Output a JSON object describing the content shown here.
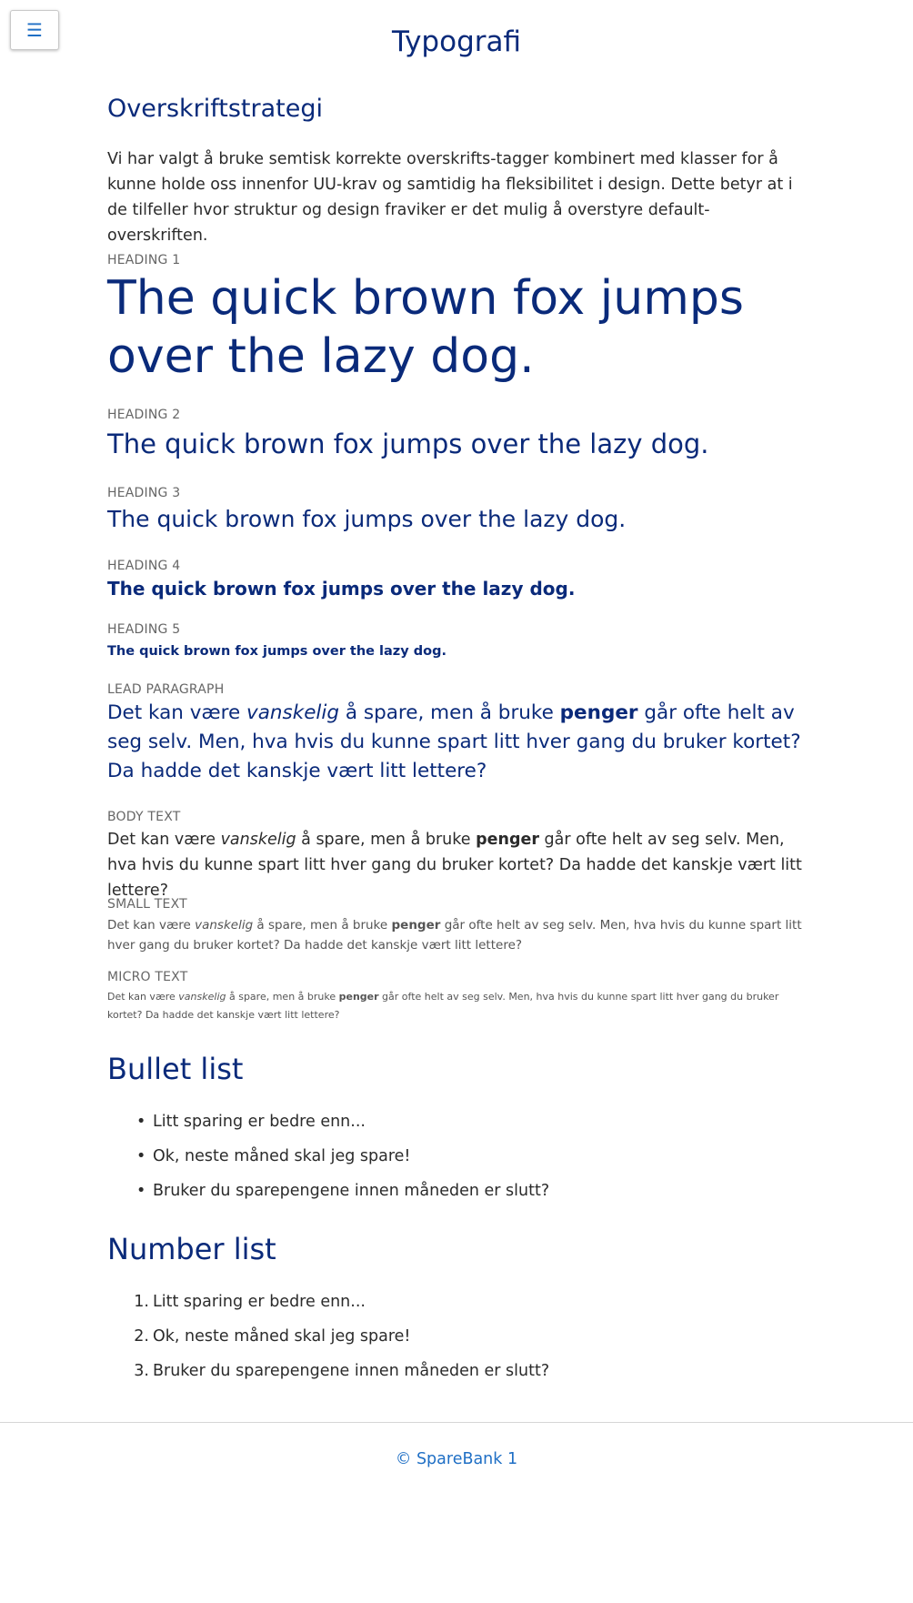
{
  "menu": {
    "icon": "hamburger-menu-icon",
    "glyph": "☰"
  },
  "page_title": "Typografi",
  "strategy": {
    "title": "Overskriftstrategi",
    "text": "Vi har valgt å bruke semtisk korrekte overskrifts-tagger kombinert med klasser for å kunne holde oss innenfor UU-krav og samtidig ha fleksibilitet i design. Dette betyr at i de tilfeller hvor struktur og design fraviker er det mulig å overstyre default-overskriften."
  },
  "headings": [
    {
      "label": "HEADING 1",
      "text": "The quick brown fox jumps over the lazy dog."
    },
    {
      "label": "HEADING 2",
      "text": "The quick brown fox jumps over the lazy dog."
    },
    {
      "label": "HEADING 3",
      "text": "The quick brown fox jumps over the lazy dog."
    },
    {
      "label": "HEADING 4",
      "text": "The quick brown fox jumps over the lazy dog."
    },
    {
      "label": "HEADING 5",
      "text": "The quick brown fox jumps over the lazy dog."
    }
  ],
  "sample": {
    "part1": "Det kan være ",
    "italic": "vanskelig",
    "part2": " å spare, men å bruke ",
    "bold": "penger",
    "part3": " går ofte helt av seg selv. Men, hva hvis du kunne spart litt hver gang du bruker kortet? Da hadde det kanskje vært litt lettere?"
  },
  "text_styles": {
    "lead_label": "LEAD PARAGRAPH",
    "body_label": "BODY TEXT",
    "small_label": "SMALL TEXT",
    "micro_label": "MICRO TEXT"
  },
  "bullet_list": {
    "title": "Bullet list",
    "marker": "•",
    "items": [
      "Litt sparing er bedre enn...",
      "Ok, neste måned skal jeg spare!",
      "Bruker du sparepengene innen måneden er slutt?"
    ]
  },
  "number_list": {
    "title": "Number list",
    "numbers": [
      "1.",
      "2.",
      "3."
    ],
    "items": [
      "Litt sparing er bedre enn...",
      "Ok, neste måned skal jeg spare!",
      "Bruker du sparepengene innen måneden er slutt?"
    ]
  },
  "footer": {
    "copyright": "© SpareBank 1"
  },
  "colors": {
    "heading": "#0a2a7a",
    "link": "#1f6fc5",
    "text": "#2b2b2b",
    "label": "#666666"
  }
}
